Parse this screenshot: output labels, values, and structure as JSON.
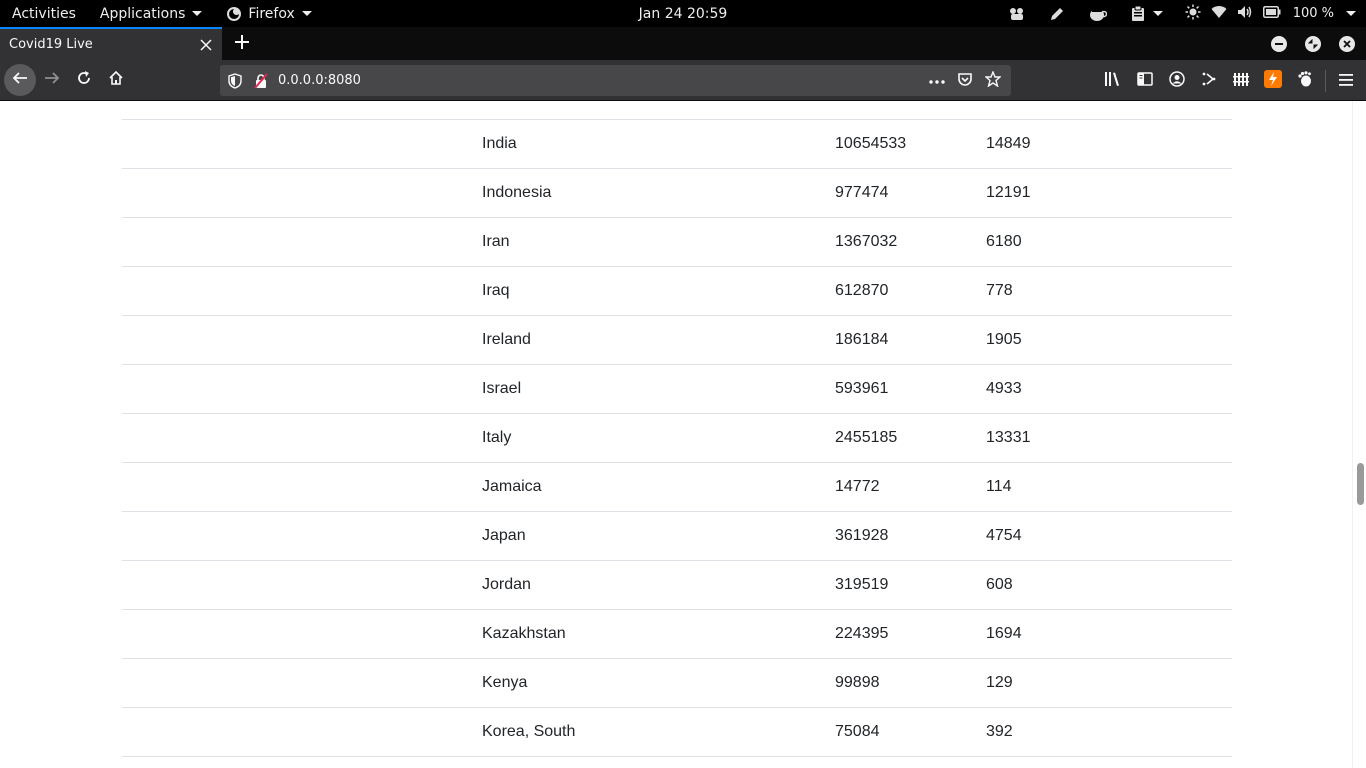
{
  "topbar": {
    "activities": "Activities",
    "applications": "Applications",
    "app_menu": "Firefox",
    "clock": "Jan 24  20:59",
    "battery": "100 %"
  },
  "browser": {
    "tab_title": "Covid19  Live",
    "url": "0.0.0.0:8080"
  },
  "table": {
    "rows": [
      {
        "country": "India",
        "cases": "10654533",
        "deaths": "14849"
      },
      {
        "country": "Indonesia",
        "cases": "977474",
        "deaths": "12191"
      },
      {
        "country": "Iran",
        "cases": "1367032",
        "deaths": "6180"
      },
      {
        "country": "Iraq",
        "cases": "612870",
        "deaths": "778"
      },
      {
        "country": "Ireland",
        "cases": "186184",
        "deaths": "1905"
      },
      {
        "country": "Israel",
        "cases": "593961",
        "deaths": "4933"
      },
      {
        "country": "Italy",
        "cases": "2455185",
        "deaths": "13331"
      },
      {
        "country": "Jamaica",
        "cases": "14772",
        "deaths": "114"
      },
      {
        "country": "Japan",
        "cases": "361928",
        "deaths": "4754"
      },
      {
        "country": "Jordan",
        "cases": "319519",
        "deaths": "608"
      },
      {
        "country": "Kazakhstan",
        "cases": "224395",
        "deaths": "1694"
      },
      {
        "country": "Kenya",
        "cases": "99898",
        "deaths": "129"
      },
      {
        "country": "Korea, South",
        "cases": "75084",
        "deaths": "392"
      }
    ]
  }
}
